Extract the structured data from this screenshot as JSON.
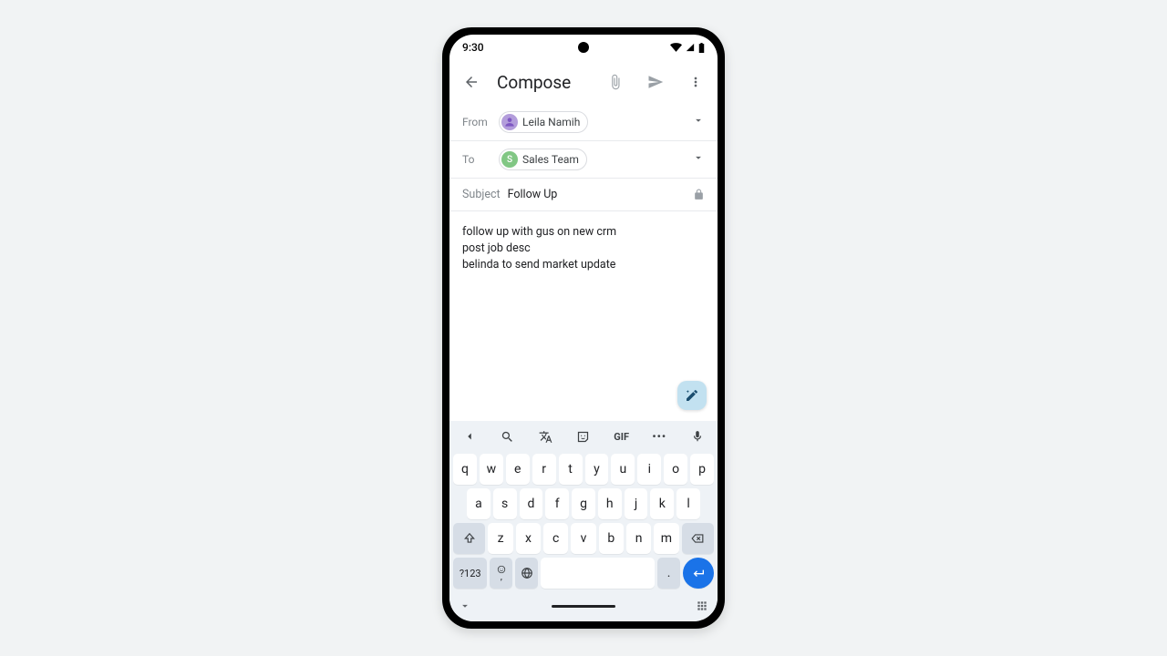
{
  "status": {
    "time": "9:30"
  },
  "appbar": {
    "title": "Compose"
  },
  "from": {
    "label": "From",
    "name": "Leila Namih"
  },
  "to": {
    "label": "To",
    "name": "Sales Team",
    "initial": "S"
  },
  "subject": {
    "label": "Subject",
    "value": "Follow Up"
  },
  "body": {
    "line1": "follow up with gus on new crm",
    "line2": "post job desc",
    "line3": "belinda to send market update"
  },
  "keyboard": {
    "gif": "GIF",
    "dots": "•••",
    "row1": {
      "k0": "q",
      "k1": "w",
      "k2": "e",
      "k3": "r",
      "k4": "t",
      "k5": "y",
      "k6": "u",
      "k7": "i",
      "k8": "o",
      "k9": "p"
    },
    "row2": {
      "k0": "a",
      "k1": "s",
      "k2": "d",
      "k3": "f",
      "k4": "g",
      "k5": "h",
      "k6": "j",
      "k7": "k",
      "k8": "l"
    },
    "row3": {
      "k0": "z",
      "k1": "x",
      "k2": "c",
      "k3": "v",
      "k4": "b",
      "k5": "n",
      "k6": "m"
    },
    "sym": "?123",
    "comma": ",",
    "period": "."
  }
}
